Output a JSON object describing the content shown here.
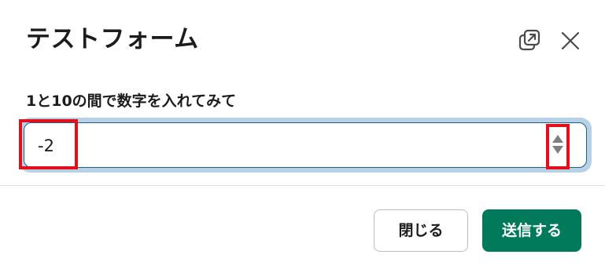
{
  "modal": {
    "title": "テストフォーム",
    "popout_icon": "popout-icon",
    "close_icon": "close-icon"
  },
  "field": {
    "label": "1と10の間で数字を入れてみて",
    "value": "-2"
  },
  "footer": {
    "close_label": "閉じる",
    "submit_label": "送信する"
  },
  "colors": {
    "submit_bg": "#007a5a",
    "focus_ring": "#b7d2e6",
    "highlight": "#e3101c"
  }
}
